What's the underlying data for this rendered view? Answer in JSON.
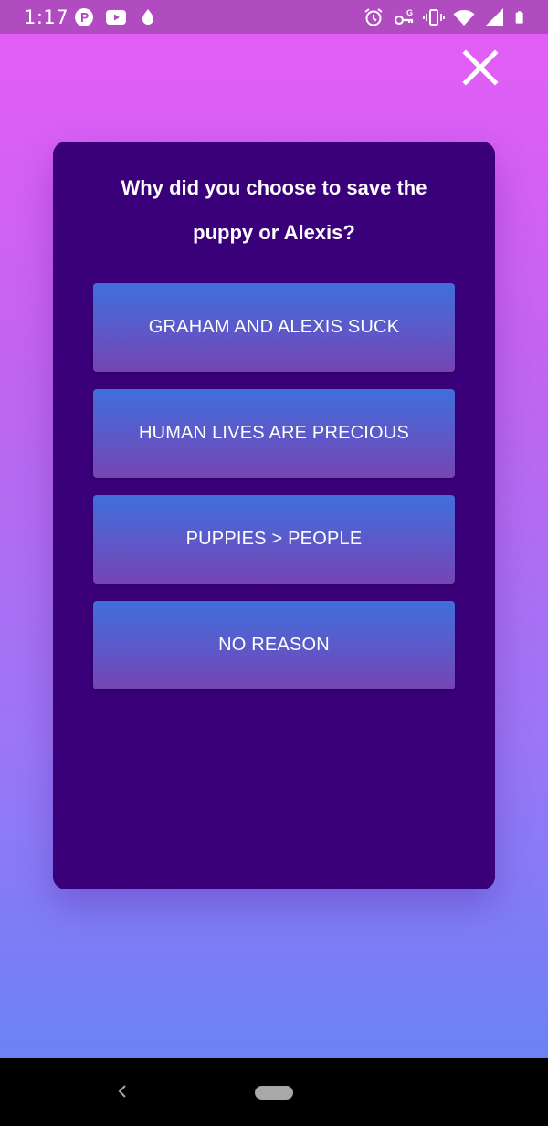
{
  "status_bar": {
    "time": "1:17",
    "left_icons": [
      "pocket-icon",
      "youtube-icon",
      "water-drop-icon"
    ],
    "right_icons": [
      "alarm-icon",
      "vpn-key-icon",
      "vibrate-icon",
      "wifi-icon",
      "signal-icon",
      "battery-icon"
    ]
  },
  "dialog": {
    "question": "Why did you choose to save the puppy or Alexis?",
    "options": [
      {
        "label": "GRAHAM AND ALEXIS SUCK"
      },
      {
        "label": "HUMAN LIVES ARE PRECIOUS"
      },
      {
        "label": "PUPPIES > PEOPLE"
      },
      {
        "label": "NO REASON"
      }
    ]
  },
  "colors": {
    "background_top": "#e65cf8",
    "background_bottom": "#6b82f6",
    "card": "#3a007a",
    "option_top": "#3f6fdb",
    "option_bottom": "#7544b3"
  }
}
